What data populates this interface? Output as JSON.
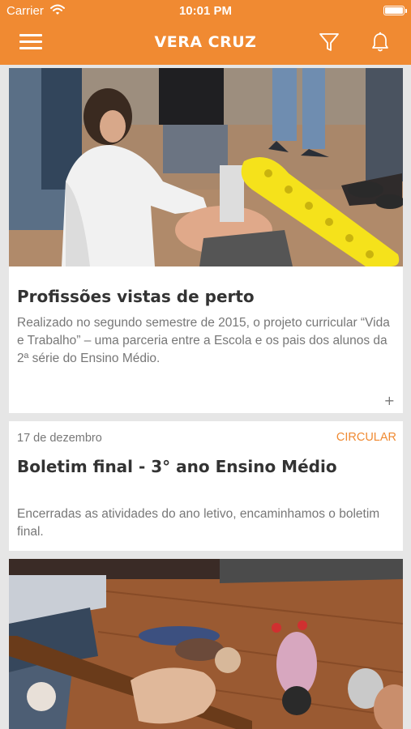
{
  "status_bar": {
    "carrier": "Carrier",
    "time": "10:01 PM"
  },
  "header": {
    "title": "VERA CRUZ",
    "background_color": "#f08a32",
    "icons": [
      "menu-icon",
      "filter-icon",
      "bell-icon"
    ]
  },
  "feed": {
    "cards": [
      {
        "title": "Profissões vistas de perto",
        "description": "Realizado no segundo semestre de 2015, o projeto curricular “Vida e Trabalho” – uma parceria entre a Escola e os pais dos alunos da 2ª série do Ensino Médio.",
        "expand_label": "+",
        "photo": "first-aid-training-photo"
      },
      {
        "date": "17 de dezembro",
        "category": "CIRCULAR",
        "title": "Boletim final - 3° ano Ensino Médio",
        "description": "Encerradas as atividades do ano letivo, encaminhamos  o boletim final."
      },
      {
        "photo": "children-activity-photo"
      }
    ]
  }
}
